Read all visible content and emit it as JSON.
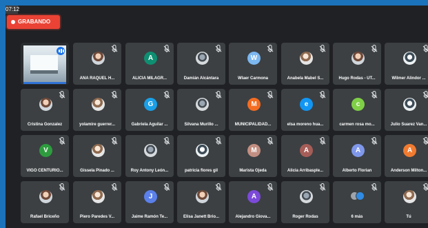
{
  "meeting": {
    "time": "07:12",
    "recording_label": "GRABANDO"
  },
  "participants": [
    {
      "name": "",
      "type": "self-video",
      "avatar": "video"
    },
    {
      "name": "ANA RAQUEL H...",
      "type": "photo",
      "avatar": "photo",
      "muted": true
    },
    {
      "name": "ALICIA MILAGR...",
      "type": "letter",
      "letter": "A",
      "color": "#0f8f72",
      "muted": true
    },
    {
      "name": "Damián Alcántara",
      "type": "photo",
      "avatar": "photo4",
      "muted": true
    },
    {
      "name": "Wlaer Carmona",
      "type": "letter",
      "letter": "W",
      "color": "#7cb7f0",
      "muted": true
    },
    {
      "name": "Anabela Mabel S...",
      "type": "photo",
      "avatar": "photo2",
      "muted": true
    },
    {
      "name": "Hugo Rodas - UT...",
      "type": "photo",
      "avatar": "photo",
      "muted": true
    },
    {
      "name": "Wilmer Alindor ...",
      "type": "photo",
      "avatar": "photo3",
      "muted": true
    },
    {
      "name": "Cristina Gonzalez",
      "type": "photo",
      "avatar": "photo",
      "muted": true
    },
    {
      "name": "yolamire guerrer...",
      "type": "photo",
      "avatar": "photo2",
      "muted": true
    },
    {
      "name": "Gabriela Aguilar ...",
      "type": "letter",
      "letter": "G",
      "color": "#1aa0e8",
      "muted": true
    },
    {
      "name": "Silvana Murillo ...",
      "type": "photo",
      "avatar": "photo4",
      "muted": true
    },
    {
      "name": "MUNICIPALIDAD...",
      "type": "letter",
      "letter": "M",
      "color": "#f46d22",
      "muted": true
    },
    {
      "name": "elsa moreno hua...",
      "type": "letter",
      "letter": "e",
      "color": "#1296f3",
      "muted": true
    },
    {
      "name": "carmen rosa mo...",
      "type": "letter",
      "letter": "c",
      "color": "#7fd046",
      "muted": true
    },
    {
      "name": "Julio Suarez Van...",
      "type": "photo",
      "avatar": "photo3",
      "muted": true
    },
    {
      "name": "VIGO CENTURIO...",
      "type": "letter",
      "letter": "V",
      "color": "#2e9c3e",
      "muted": true
    },
    {
      "name": "Gissela Pinado ...",
      "type": "photo",
      "avatar": "photo2",
      "muted": true
    },
    {
      "name": "Roy Antony León...",
      "type": "photo",
      "avatar": "photo4",
      "muted": true
    },
    {
      "name": "patricia flores gil",
      "type": "photo",
      "avatar": "photo3",
      "muted": true
    },
    {
      "name": "Marista Ojeda",
      "type": "letter",
      "letter": "M",
      "color": "#c28f82",
      "muted": true
    },
    {
      "name": "Alicia Arribasple...",
      "type": "letter",
      "letter": "A",
      "color": "#a65d58",
      "muted": true
    },
    {
      "name": "Alberto Florian",
      "type": "letter",
      "letter": "A",
      "color": "#7f97ea",
      "muted": true
    },
    {
      "name": "Anderson Milton...",
      "type": "letter",
      "letter": "A",
      "color": "#f17b30",
      "muted": true
    },
    {
      "name": "Rafael Briceño",
      "type": "photo",
      "avatar": "photo",
      "muted": true
    },
    {
      "name": "Piero Paredes V...",
      "type": "photo",
      "avatar": "photo2",
      "muted": true
    },
    {
      "name": "Jaime Ramón Te...",
      "type": "letter",
      "letter": "J",
      "color": "#5b80ea",
      "muted": true
    },
    {
      "name": "Elisa Janett Brio...",
      "type": "photo",
      "avatar": "photo",
      "muted": true
    },
    {
      "name": "Alejandro Giova...",
      "type": "letter",
      "letter": "A",
      "color": "#7c4ad9",
      "muted": true
    },
    {
      "name": "Roger Rodas",
      "type": "photo",
      "avatar": "photo4",
      "muted": true
    },
    {
      "name": "6 más",
      "type": "more",
      "count_label": "6 más",
      "muted": true
    },
    {
      "name": "Tú",
      "type": "photo",
      "avatar": "photo2",
      "muted": true
    }
  ]
}
